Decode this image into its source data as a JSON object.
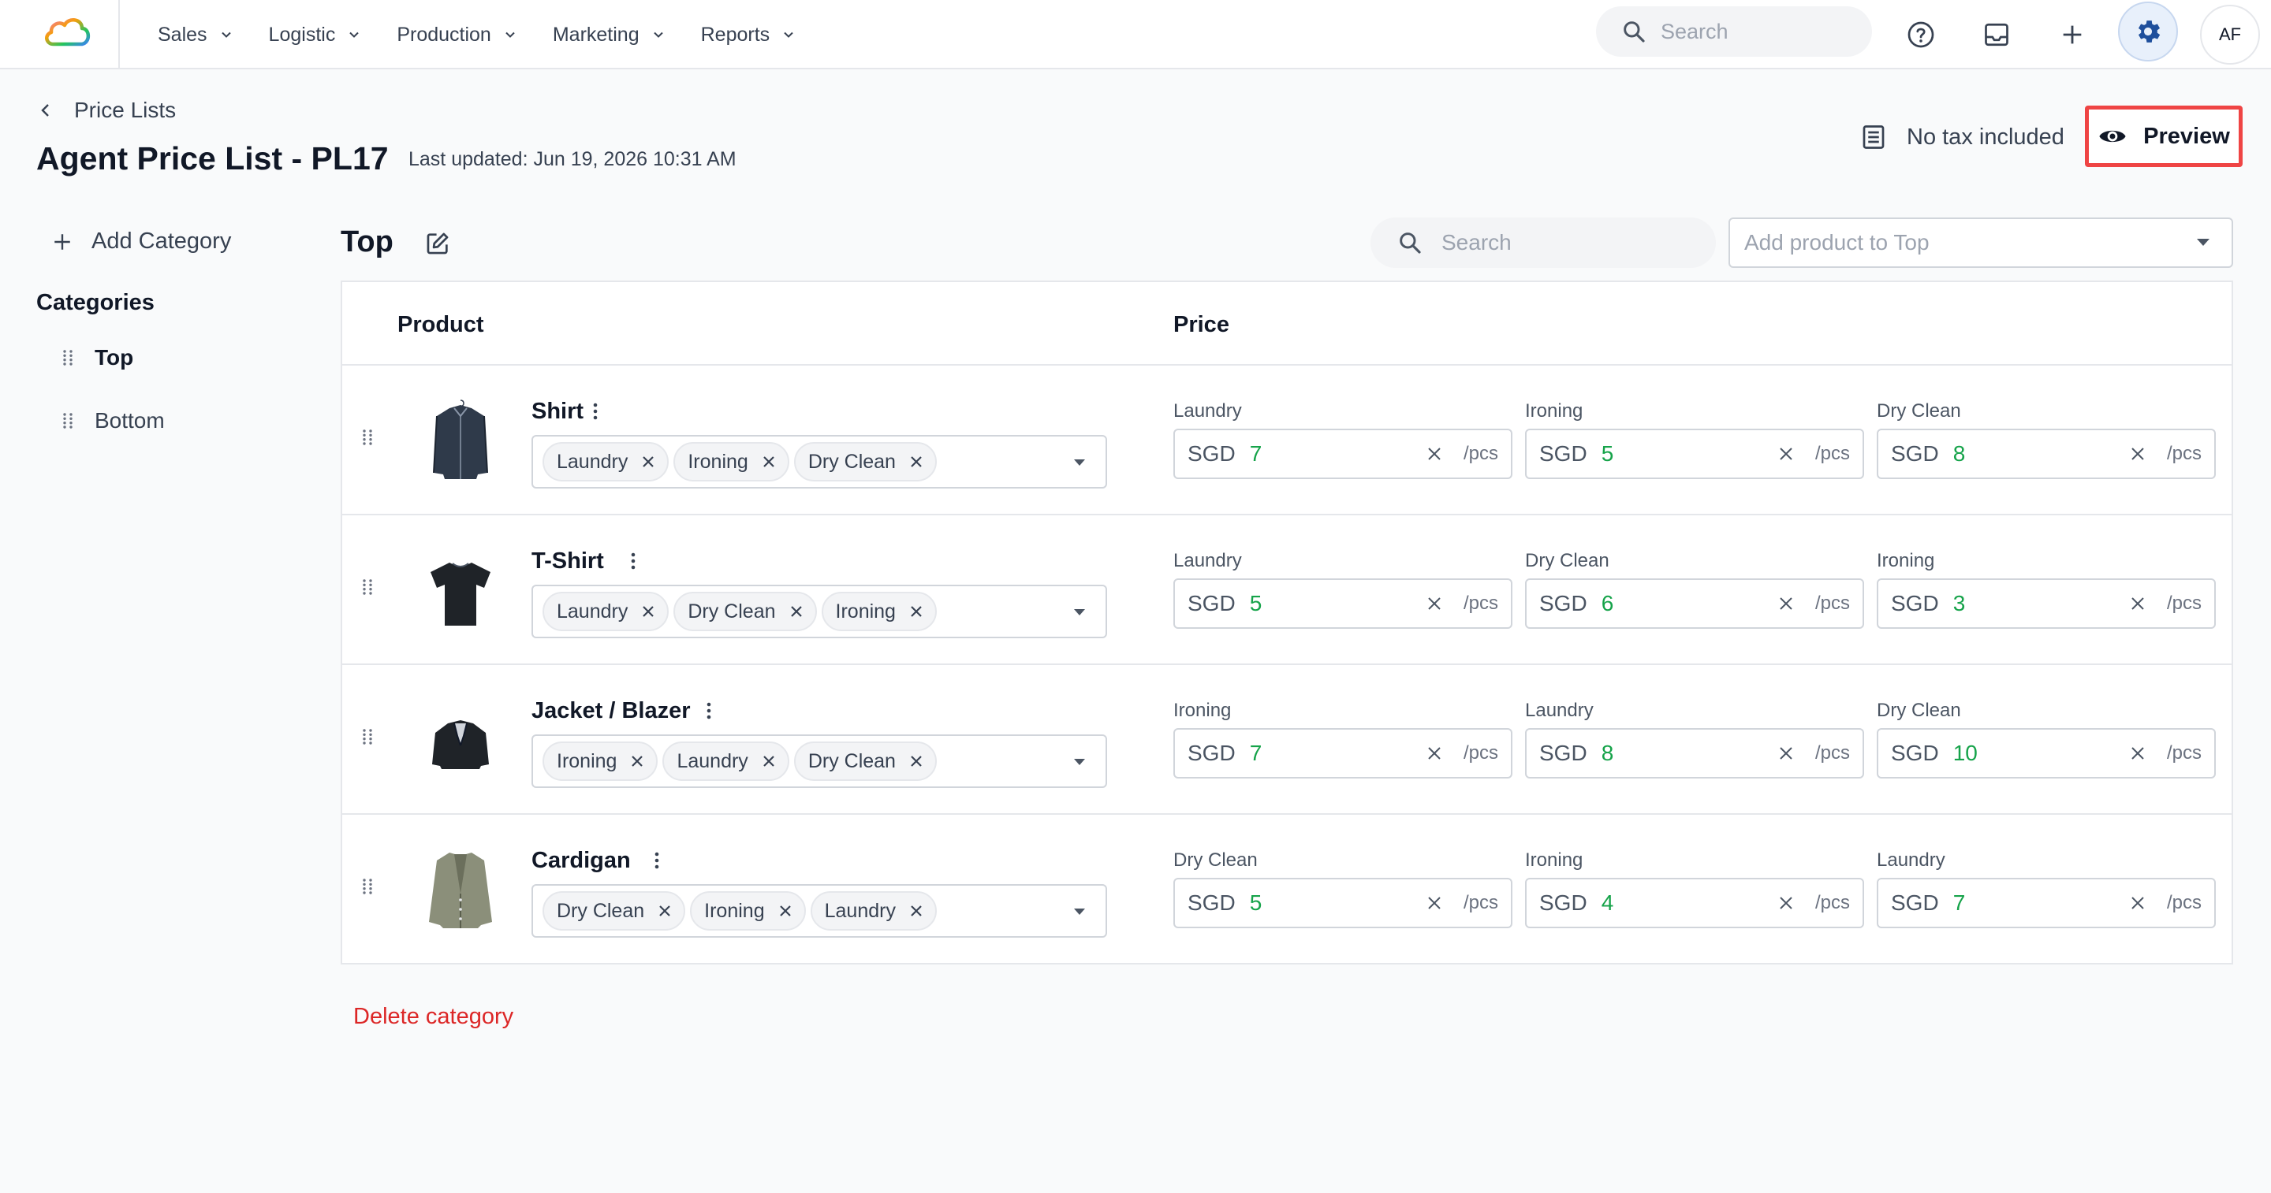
{
  "nav": {
    "items": [
      {
        "label": "Sales"
      },
      {
        "label": "Logistic"
      },
      {
        "label": "Production"
      },
      {
        "label": "Marketing"
      },
      {
        "label": "Reports"
      }
    ],
    "search_placeholder": "Search",
    "user_initials": "AF",
    "icons": [
      "help-icon",
      "inbox-icon",
      "plus-icon",
      "gear-icon"
    ]
  },
  "header": {
    "back_label": "Price Lists",
    "title": "Agent Price List - PL17",
    "last_updated": "Last updated: Jun 19, 2026 10:31 AM",
    "tax_label": "No tax included",
    "preview_label": "Preview"
  },
  "sidebar": {
    "add_category_label": "Add Category",
    "categories_heading": "Categories",
    "categories": [
      {
        "label": "Top",
        "active": true
      },
      {
        "label": "Bottom",
        "active": false
      }
    ]
  },
  "main": {
    "category_title": "Top",
    "search_placeholder": "Search",
    "add_product_placeholder": "Add product to Top",
    "columns": {
      "product": "Product",
      "price": "Price"
    },
    "currency": "SGD",
    "unit": "/pcs",
    "delete_category_label": "Delete category",
    "products": [
      {
        "name": "Shirt",
        "services": [
          "Laundry",
          "Ironing",
          "Dry Clean"
        ],
        "prices": [
          {
            "service": "Laundry",
            "value": "7"
          },
          {
            "service": "Ironing",
            "value": "5"
          },
          {
            "service": "Dry Clean",
            "value": "8"
          }
        ]
      },
      {
        "name": "T-Shirt",
        "services": [
          "Laundry",
          "Dry Clean",
          "Ironing"
        ],
        "prices": [
          {
            "service": "Laundry",
            "value": "5"
          },
          {
            "service": "Dry Clean",
            "value": "6"
          },
          {
            "service": "Ironing",
            "value": "3"
          }
        ]
      },
      {
        "name": "Jacket / Blazer",
        "services": [
          "Ironing",
          "Laundry",
          "Dry Clean"
        ],
        "prices": [
          {
            "service": "Ironing",
            "value": "7"
          },
          {
            "service": "Laundry",
            "value": "8"
          },
          {
            "service": "Dry Clean",
            "value": "10"
          }
        ]
      },
      {
        "name": "Cardigan",
        "services": [
          "Dry Clean",
          "Ironing",
          "Laundry"
        ],
        "prices": [
          {
            "service": "Dry Clean",
            "value": "5"
          },
          {
            "service": "Ironing",
            "value": "4"
          },
          {
            "service": "Laundry",
            "value": "7"
          }
        ]
      }
    ]
  },
  "colors": {
    "price_value": "#16a34a",
    "preview_highlight": "#ef4444",
    "delete": "#dc2626",
    "gear_accent": "#1e4f9c"
  }
}
